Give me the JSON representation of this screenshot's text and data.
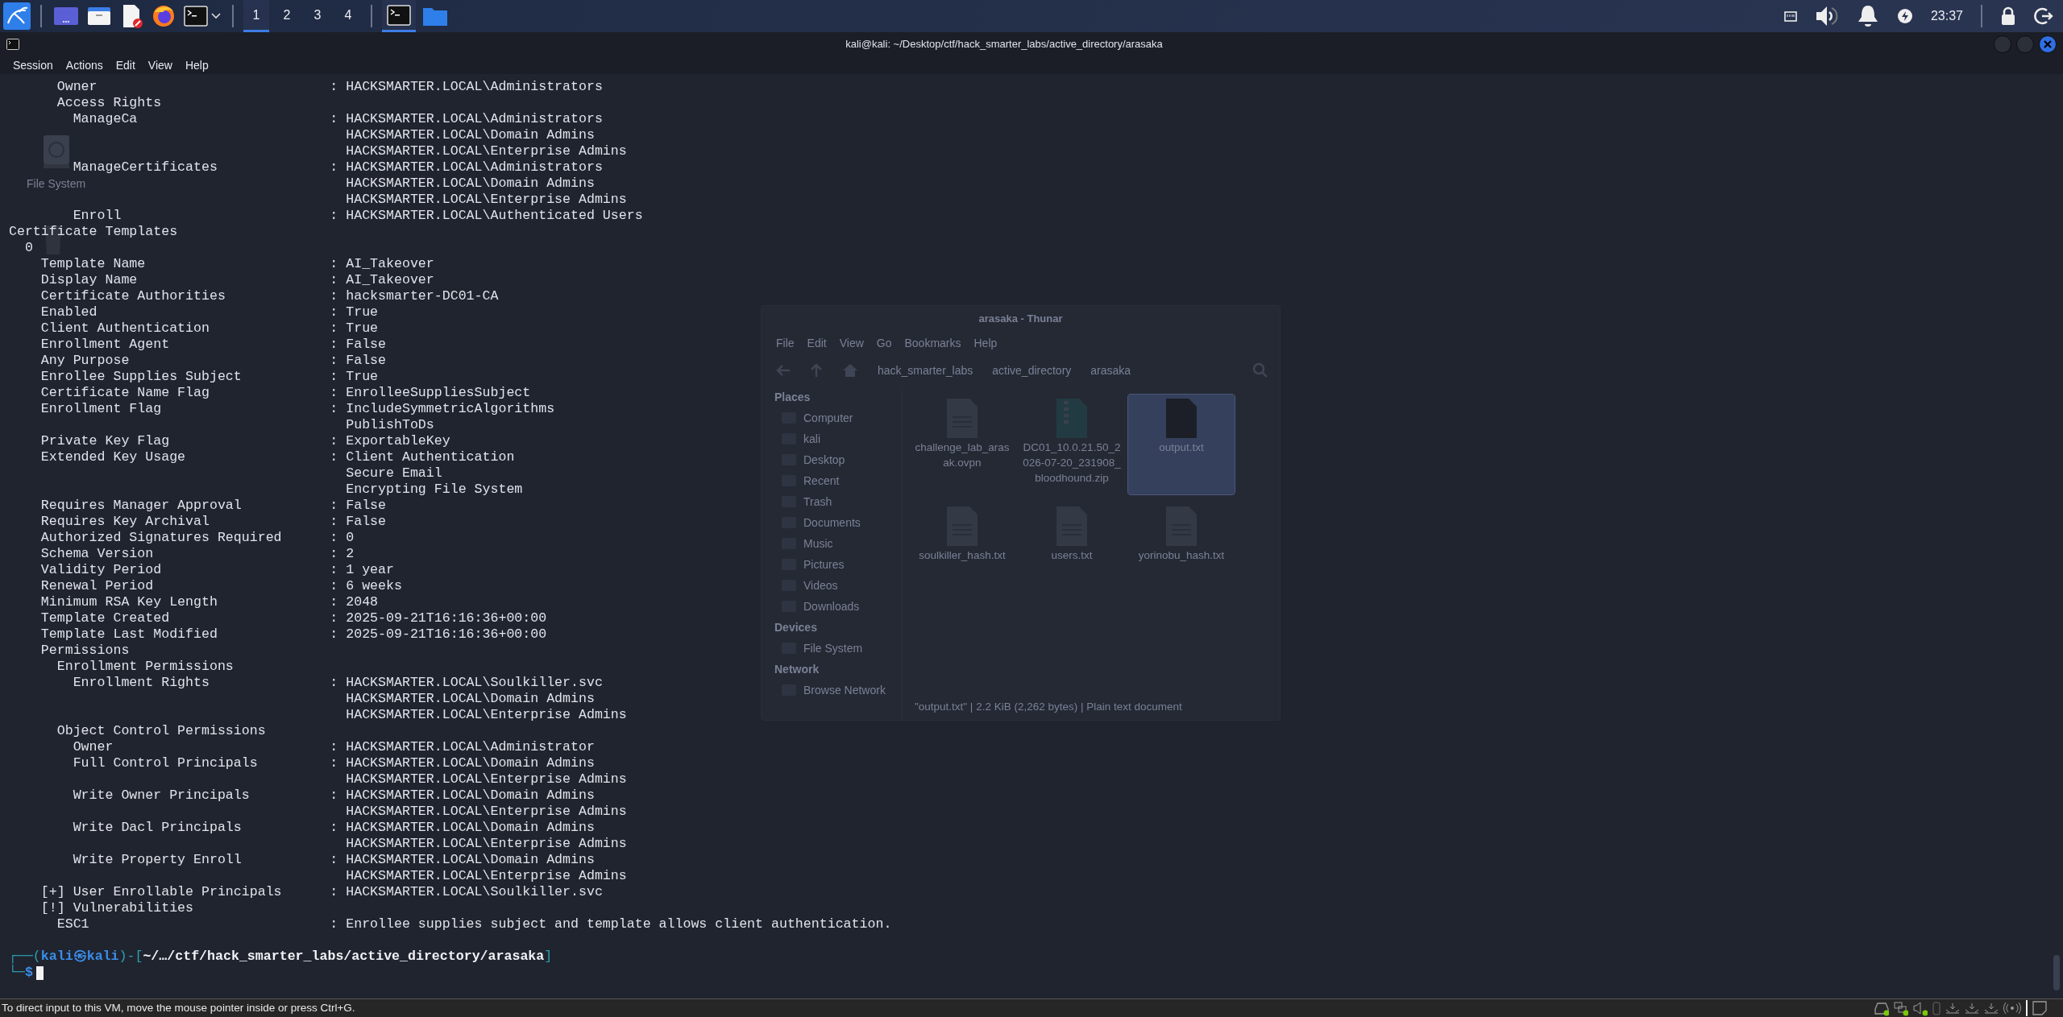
{
  "taskbar": {
    "workspaces": [
      {
        "label": "1",
        "selected": true
      },
      {
        "label": "2",
        "selected": false
      },
      {
        "label": "3",
        "selected": false
      },
      {
        "label": "4",
        "selected": false
      }
    ],
    "clock": "23:37"
  },
  "window": {
    "title": "kali@kali: ~/Desktop/ctf/hack_smarter_labs/active_directory/arasaka",
    "menu": [
      "Session",
      "Actions",
      "Edit",
      "View",
      "Help"
    ]
  },
  "desktop_icons": [
    {
      "label": "File System"
    }
  ],
  "background_window": {
    "title": "arasaka - Thunar",
    "menu": [
      "File",
      "Edit",
      "View",
      "Go",
      "Bookmarks",
      "Help"
    ],
    "path": [
      "hack_smarter_labs",
      "active_directory",
      "arasaka"
    ],
    "sidebar": [
      {
        "heading": "Places",
        "items": [
          "Computer",
          "kali",
          "Desktop",
          "Recent",
          "Trash",
          "Documents",
          "Music",
          "Pictures",
          "Videos",
          "Downloads"
        ]
      },
      {
        "heading": "Devices",
        "items": [
          "File System"
        ]
      },
      {
        "heading": "Network",
        "items": [
          "Browse Network"
        ]
      }
    ],
    "files": [
      {
        "name": "challenge_lab_arasak.ovpn",
        "kind": "text",
        "selected": false
      },
      {
        "name": "DC01_10.0.21.50_2026-07-20_231908_bloodhound.zip",
        "kind": "archive",
        "selected": false
      },
      {
        "name": "output.txt",
        "kind": "blank",
        "selected": true
      },
      {
        "name": "soulkiller_hash.txt",
        "kind": "text",
        "selected": false
      },
      {
        "name": "users.txt",
        "kind": "text",
        "selected": false
      },
      {
        "name": "yorinobu_hash.txt",
        "kind": "text",
        "selected": false
      }
    ],
    "status": "\"output.txt\" | 2.2 KiB (2,262 bytes) | Plain text document"
  },
  "terminal": {
    "ca_permissions": [
      {
        "key": "Owner",
        "sep": ":",
        "values": [
          "HACKSMARTER.LOCAL\\Administrators"
        ]
      },
      {
        "key": "Access Rights",
        "children": [
          {
            "key": "ManageCa",
            "sep": ":",
            "values": [
              "HACKSMARTER.LOCAL\\Administrators",
              "HACKSMARTER.LOCAL\\Domain Admins",
              "HACKSMARTER.LOCAL\\Enterprise Admins"
            ]
          },
          {
            "key": "ManageCertificates",
            "sep": ":",
            "values": [
              "HACKSMARTER.LOCAL\\Administrators",
              "HACKSMARTER.LOCAL\\Domain Admins",
              "HACKSMARTER.LOCAL\\Enterprise Admins"
            ]
          },
          {
            "key": "Enroll",
            "sep": ":",
            "values": [
              "HACKSMARTER.LOCAL\\Authenticated Users"
            ]
          }
        ]
      }
    ],
    "sections": [
      {
        "key": "Certificate Templates",
        "children": [
          {
            "key": "0",
            "children": [
              {
                "key": "Template Name",
                "sep": ":",
                "values": [
                  "AI_Takeover"
                ]
              },
              {
                "key": "Display Name",
                "sep": ":",
                "values": [
                  "AI_Takeover"
                ]
              },
              {
                "key": "Certificate Authorities",
                "sep": ":",
                "values": [
                  "hacksmarter-DC01-CA"
                ]
              },
              {
                "key": "Enabled",
                "sep": ":",
                "values": [
                  "True"
                ]
              },
              {
                "key": "Client Authentication",
                "sep": ":",
                "values": [
                  "True"
                ]
              },
              {
                "key": "Enrollment Agent",
                "sep": ":",
                "values": [
                  "False"
                ]
              },
              {
                "key": "Any Purpose",
                "sep": ":",
                "values": [
                  "False"
                ]
              },
              {
                "key": "Enrollee Supplies Subject",
                "sep": ":",
                "values": [
                  "True"
                ]
              },
              {
                "key": "Certificate Name Flag",
                "sep": ":",
                "values": [
                  "EnrolleeSuppliesSubject"
                ]
              },
              {
                "key": "Enrollment Flag",
                "sep": ":",
                "values": [
                  "IncludeSymmetricAlgorithms",
                  "PublishToDs"
                ]
              },
              {
                "key": "Private Key Flag",
                "sep": ":",
                "values": [
                  "ExportableKey"
                ]
              },
              {
                "key": "Extended Key Usage",
                "sep": ":",
                "values": [
                  "Client Authentication",
                  "Secure Email",
                  "Encrypting File System"
                ]
              },
              {
                "key": "Requires Manager Approval",
                "sep": ":",
                "values": [
                  "False"
                ]
              },
              {
                "key": "Requires Key Archival",
                "sep": ":",
                "values": [
                  "False"
                ]
              },
              {
                "key": "Authorized Signatures Required",
                "sep": ":",
                "values": [
                  "0"
                ]
              },
              {
                "key": "Schema Version",
                "sep": ":",
                "values": [
                  "2"
                ]
              },
              {
                "key": "Validity Period",
                "sep": ":",
                "values": [
                  "1 year"
                ]
              },
              {
                "key": "Renewal Period",
                "sep": ":",
                "values": [
                  "6 weeks"
                ]
              },
              {
                "key": "Minimum RSA Key Length",
                "sep": ":",
                "values": [
                  "2048"
                ]
              },
              {
                "key": "Template Created",
                "sep": ":",
                "values": [
                  "2025-09-21T16:16:36+00:00"
                ]
              },
              {
                "key": "Template Last Modified",
                "sep": ":",
                "values": [
                  "2025-09-21T16:16:36+00:00"
                ]
              },
              {
                "key": "Permissions",
                "children": [
                  {
                    "key": "Enrollment Permissions",
                    "children": [
                      {
                        "key": "Enrollment Rights",
                        "sep": ":",
                        "values": [
                          "HACKSMARTER.LOCAL\\Soulkiller.svc",
                          "HACKSMARTER.LOCAL\\Domain Admins",
                          "HACKSMARTER.LOCAL\\Enterprise Admins"
                        ]
                      }
                    ]
                  },
                  {
                    "key": "Object Control Permissions",
                    "children": [
                      {
                        "key": "Owner",
                        "sep": ":",
                        "values": [
                          "HACKSMARTER.LOCAL\\Administrator"
                        ]
                      },
                      {
                        "key": "Full Control Principals",
                        "sep": ":",
                        "values": [
                          "HACKSMARTER.LOCAL\\Domain Admins",
                          "HACKSMARTER.LOCAL\\Enterprise Admins"
                        ]
                      },
                      {
                        "key": "Write Owner Principals",
                        "sep": ":",
                        "values": [
                          "HACKSMARTER.LOCAL\\Domain Admins",
                          "HACKSMARTER.LOCAL\\Enterprise Admins"
                        ]
                      },
                      {
                        "key": "Write Dacl Principals",
                        "sep": ":",
                        "values": [
                          "HACKSMARTER.LOCAL\\Domain Admins",
                          "HACKSMARTER.LOCAL\\Enterprise Admins"
                        ]
                      },
                      {
                        "key": "Write Property Enroll",
                        "sep": ":",
                        "values": [
                          "HACKSMARTER.LOCAL\\Domain Admins",
                          "HACKSMARTER.LOCAL\\Enterprise Admins"
                        ]
                      }
                    ]
                  }
                ]
              },
              {
                "key": "[+] User Enrollable Principals",
                "sep": ":",
                "values": [
                  "HACKSMARTER.LOCAL\\Soulkiller.svc"
                ]
              },
              {
                "key": "[!] Vulnerabilities",
                "children": [
                  {
                    "key": "ESC1",
                    "sep": ":",
                    "values": [
                      "Enrollee supplies subject and template allows client authentication."
                    ]
                  }
                ]
              }
            ]
          }
        ]
      }
    ],
    "prompt": {
      "open": "┌──(",
      "user_host": "kali㉿kali",
      "mid": ")-[",
      "path": "~/…/ctf/hack_smarter_labs/active_directory/arasaka",
      "close": "]",
      "corner": "└─",
      "symbol": "$"
    }
  },
  "status_bar": {
    "text": "To direct input to this VM, move the mouse pointer inside or press Ctrl+G."
  }
}
